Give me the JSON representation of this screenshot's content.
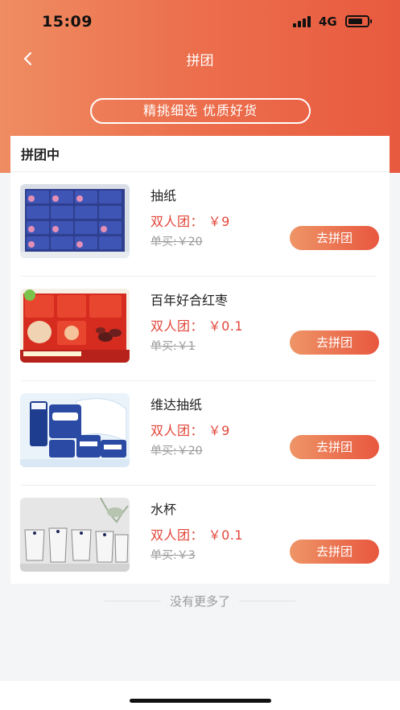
{
  "status": {
    "time": "15:09",
    "network": "4G"
  },
  "nav": {
    "title": "拼团"
  },
  "banner": {
    "slogan": "精挑细选 优质好货"
  },
  "section": {
    "title": "拼团中"
  },
  "products": [
    {
      "name": "抽纸",
      "group_price": "双人团： ￥9",
      "single_price": "单买:￥20",
      "button": "去拼团",
      "image": "tissue-box-pack"
    },
    {
      "name": "百年好合红枣",
      "group_price": "双人团： ￥0.1",
      "single_price": "单买:￥1",
      "button": "去拼团",
      "image": "red-dates-pack"
    },
    {
      "name": "维达抽纸",
      "group_price": "双人团： ￥9",
      "single_price": "单买:￥20",
      "button": "去拼团",
      "image": "vinda-tissue"
    },
    {
      "name": "水杯",
      "group_price": "双人团： ￥0.1",
      "single_price": "单买:￥3",
      "button": "去拼团",
      "image": "glass-cups"
    }
  ],
  "footer": {
    "no_more": "没有更多了"
  },
  "colors": {
    "accent": "#e85a3f",
    "price": "#e2473b",
    "header_start": "#ef8c62"
  }
}
